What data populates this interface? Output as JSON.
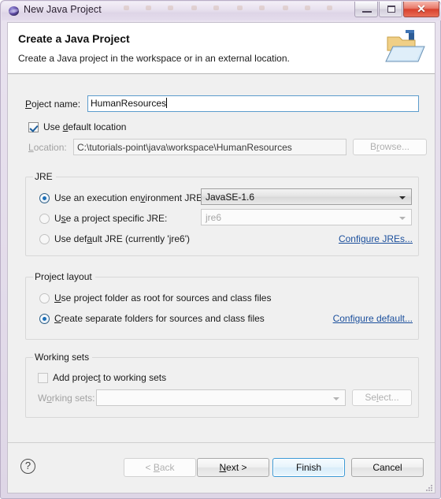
{
  "window": {
    "title": "New Java Project",
    "icon": "eclipse-sphere-icon",
    "controls": {
      "minimize": "minimize-icon",
      "maximize": "maximize-icon",
      "close": "✕"
    }
  },
  "header": {
    "title": "Create a Java Project",
    "description": "Create a Java project in the workspace or in an external location.",
    "icon": "java-project-folder-icon"
  },
  "form": {
    "project_name": {
      "label_pre": "P",
      "label_mnemonic": "r",
      "label_post": "oject name:",
      "label_full": "Project name:",
      "value": "HumanResources",
      "placeholder": ""
    },
    "use_default_location": {
      "label_pre": "Use ",
      "label_mnemonic": "d",
      "label_post": "efault location",
      "label_full": "Use default location",
      "checked": true
    },
    "location": {
      "label": "Location:",
      "value": "C:\\tutorials-point\\java\\workspace\\HumanResources",
      "enabled": false,
      "browse_pre": "B",
      "browse_mnemonic": "r",
      "browse_post": "owse...",
      "browse_full": "Browse..."
    }
  },
  "jre": {
    "group_label": "JRE",
    "option_exec_env": {
      "label_pre": "Use an execution en",
      "label_mnemonic": "v",
      "label_post": "ironment JRE:",
      "label_full": "Use an execution environment JRE:",
      "selected": true
    },
    "exec_env_combo": {
      "value": "JavaSE-1.6",
      "enabled": true
    },
    "option_project_specific": {
      "label_pre": "U",
      "label_mnemonic": "s",
      "label_post": "e a project specific JRE:",
      "label_full": "Use a project specific JRE:",
      "selected": false
    },
    "project_specific_combo": {
      "value": "jre6",
      "enabled": false
    },
    "option_default_jre": {
      "label_pre": "Use def",
      "label_mnemonic": "a",
      "label_post": "ult JRE (currently 'jre6')",
      "label_full": "Use default JRE (currently 'jre6')",
      "selected": false
    },
    "configure_link": "Configure JREs..."
  },
  "project_layout": {
    "group_label": "Project layout",
    "option_project_folder": {
      "label_pre": "",
      "label_mnemonic": "U",
      "label_post": "se project folder as root for sources and class files",
      "label_full": "Use project folder as root for sources and class files",
      "selected": false
    },
    "option_separate_folders": {
      "label_pre": "",
      "label_mnemonic": "C",
      "label_post": "reate separate folders for sources and class files",
      "label_full": "Create separate folders for sources and class files",
      "selected": true
    },
    "configure_link": "Configure default..."
  },
  "working_sets": {
    "group_label": "Working sets",
    "add_checkbox": {
      "label_pre": "Add projec",
      "label_mnemonic": "t",
      "label_post": " to working sets",
      "label_full": "Add project to working sets",
      "checked": false
    },
    "label_pre": "W",
    "label_mnemonic": "o",
    "label_post": "rking sets:",
    "label_full": "Working sets:",
    "combo_value": "",
    "combo_enabled": false,
    "select_pre": "Se",
    "select_mnemonic": "l",
    "select_post": "ect...",
    "select_full": "Select..."
  },
  "footer": {
    "help_icon": "?",
    "back": {
      "pre": "< ",
      "mnemonic": "B",
      "post": "ack",
      "full": "< Back",
      "enabled": false
    },
    "next": {
      "pre": "",
      "mnemonic": "N",
      "post": "ext >",
      "full": "Next >",
      "enabled": true
    },
    "finish": {
      "pre": "",
      "mnemonic": "",
      "post": "Finish",
      "full": "Finish",
      "enabled": true,
      "default": true
    },
    "cancel": {
      "pre": "",
      "mnemonic": "",
      "post": "Cancel",
      "full": "Cancel",
      "enabled": true
    }
  },
  "colors": {
    "accent_link": "#1b4f9c",
    "default_button_border": "#3c9ad6",
    "focus_field_border": "#5c9ccc",
    "close_button": "#d8412e",
    "dialog_bg": "#f0f0f0",
    "frame": "#ded6e6"
  }
}
